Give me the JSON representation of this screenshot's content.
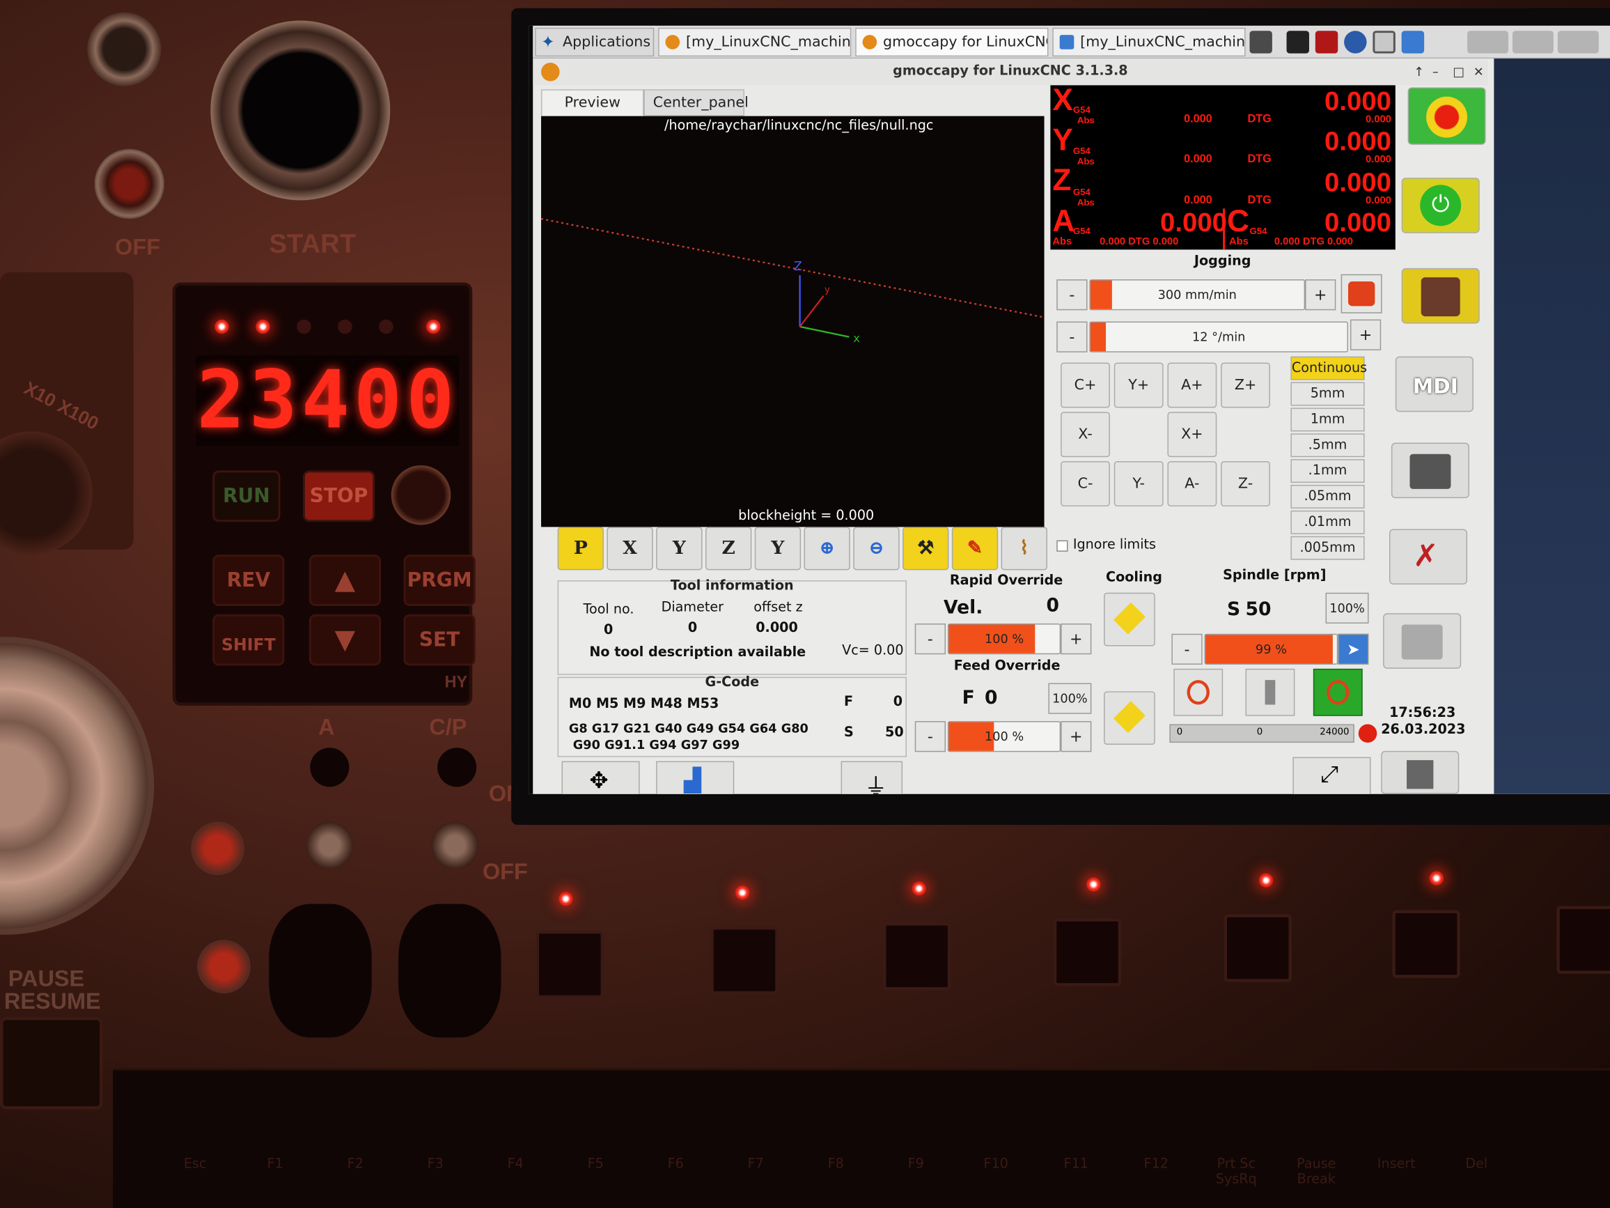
{
  "panel": {
    "vfd_display": "23400",
    "vfd_run": "RUN",
    "vfd_stop": "STOP",
    "vfd_rev": "REV",
    "vfd_prgm": "PRGM",
    "vfd_shift": "SHIFT",
    "vfd_set": "SET",
    "vfd_brand": "HY",
    "start_label": "START",
    "off_label": "OFF",
    "on_label": "ON",
    "knob_label": "X10 X100",
    "pause_label": "PAUSE",
    "resume_label": "RESUME",
    "switch_a": "A",
    "switch_cp": "C/P",
    "switch_on": "ON",
    "switch_off": "OFF",
    "fkeys": [
      "Esc",
      "F1",
      "F2",
      "F3",
      "F4",
      "F5",
      "F6",
      "F7",
      "F8",
      "F9",
      "F10",
      "F11",
      "F12",
      "Prt Sc SysRq",
      "Pause Break",
      "Insert",
      "Del"
    ]
  },
  "taskbar": {
    "applications": "Applications",
    "tasks": [
      "[my_LinuxCNC_machine...",
      "gmoccapy for LinuxCNC...",
      "[my_LinuxCNC_machine..."
    ]
  },
  "window": {
    "title": "gmoccapy for LinuxCNC  3.1.3.8",
    "tabs": [
      "Preview",
      "Center_panel"
    ],
    "filepath": "/home/raychar/linuxcnc/nc_files/null.ngc",
    "blockheight": "blockheight = 0.000"
  },
  "dro": {
    "axes": [
      {
        "name": "X",
        "sys": "G54",
        "mode": "Abs",
        "value": "0.000",
        "dtg_label": "DTG",
        "dtg": "0.000",
        "sub": "0.000"
      },
      {
        "name": "Y",
        "sys": "G54",
        "mode": "Abs",
        "value": "0.000",
        "dtg_label": "DTG",
        "dtg": "0.000",
        "sub": "0.000"
      },
      {
        "name": "Z",
        "sys": "G54",
        "mode": "Abs",
        "value": "0.000",
        "dtg_label": "DTG",
        "dtg": "0.000",
        "sub": "0.000"
      }
    ],
    "a": {
      "name": "A",
      "sys": "G54",
      "mode": "Abs",
      "value": "0.000",
      "row": "0.000 DTG 0.000"
    },
    "c": {
      "name": "C",
      "sys": "G54",
      "mode": "Abs",
      "value": "0.000",
      "row": "0.000 DTG 0.000"
    }
  },
  "jogging": {
    "title": "Jogging",
    "linear_speed": "300 mm/min",
    "linear_fraction": 0.1,
    "angular_speed": "12 °/min",
    "angular_fraction": 0.06,
    "buttons": [
      "C+",
      "Y+",
      "A+",
      "Z+",
      "X-",
      "X+",
      "C-",
      "Y-",
      "A-",
      "Z-"
    ],
    "increments": [
      "Continuous",
      "5mm",
      "1mm",
      ".5mm",
      ".1mm",
      ".05mm",
      ".01mm",
      ".005mm"
    ],
    "ignore_limits": "Ignore limits",
    "minus": "-",
    "plus": "+"
  },
  "tool": {
    "title": "Tool information",
    "h_no": "Tool no.",
    "h_dia": "Diameter",
    "h_off": "offset z",
    "v_no": "0",
    "v_dia": "0",
    "v_off": "0.000",
    "desc": "No tool description available",
    "vc": "Vc= 0.00"
  },
  "gcode": {
    "title": "G-Code",
    "mcodes": "M0 M5 M9 M48 M53",
    "gcodes1": "G8 G17 G21 G40 G49 G54 G64 G80",
    "gcodes2": "G90 G91.1 G94 G97 G99",
    "f_label": "F",
    "f_value": "0",
    "s_label": "S",
    "s_value": "50"
  },
  "rapid": {
    "title": "Rapid Override",
    "vel_label": "Vel.",
    "vel_value": "0",
    "pct": "100 %",
    "fraction": 0.78
  },
  "feed": {
    "title": "Feed Override",
    "f_label": "F",
    "f_value": "0",
    "reset": "100%",
    "pct": "100 %",
    "fraction": 0.41
  },
  "cooling": {
    "title": "Cooling"
  },
  "spindle": {
    "title": "Spindle [rpm]",
    "s_label": "S",
    "s_value": "50",
    "reset": "100%",
    "pct": "99 %",
    "fraction": 0.97,
    "bar_min": "0",
    "bar_cur": "0",
    "bar_max": "24000"
  },
  "sidebar": {
    "mdi": "MDI",
    "time": "17:56:23",
    "date": "26.03.2023"
  },
  "colors": {
    "accent": "#f2501a",
    "dro": "#ff1a10",
    "highlight": "#f2d21a",
    "estop_bg": "#3cb83c"
  }
}
